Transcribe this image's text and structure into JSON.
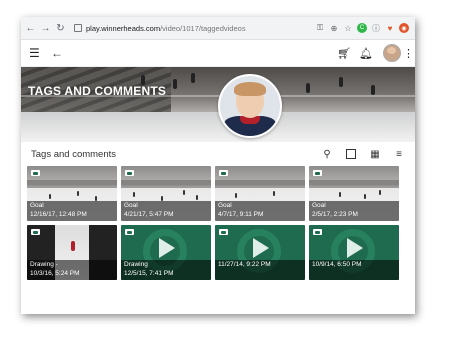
{
  "browser": {
    "url_host": "play.winnerheads.com",
    "url_path": "/video/1017/taggedvideos"
  },
  "hero": {
    "title": "TAGS AND COMMENTS"
  },
  "section": {
    "title": "Tags and comments"
  },
  "tiles": [
    {
      "type": "video",
      "title": "Goal",
      "date": "12/16/17, 12:48 PM"
    },
    {
      "type": "video",
      "title": "Goal",
      "date": "4/21/17, 5:47 PM"
    },
    {
      "type": "video",
      "title": "Goal",
      "date": "4/7/17, 9:11 PM"
    },
    {
      "type": "video",
      "title": "Goal",
      "date": "2/5/17, 2:23 PM"
    },
    {
      "type": "drawing-photo",
      "title": "Drawing -",
      "date": "10/3/16, 5:24 PM"
    },
    {
      "type": "drawing",
      "title": "Drawing",
      "date": "12/5/15, 7:41 PM"
    },
    {
      "type": "drawing",
      "title": "",
      "date": "11/27/14, 9:22 PM"
    },
    {
      "type": "drawing",
      "title": "",
      "date": "10/9/14, 6:50 PM"
    }
  ],
  "icons": {
    "browser": [
      "back-icon",
      "forward-icon",
      "reload-icon",
      "lock-icon",
      "key-icon",
      "add-icon",
      "star-icon",
      "extension-icon",
      "info-icon",
      "extension-icon",
      "extension-icon"
    ],
    "app": [
      "menu-icon",
      "back-arrow-icon",
      "cart-icon",
      "bell-icon",
      "avatar",
      "more-vert-icon"
    ],
    "tools": [
      "search-icon",
      "square-view-icon",
      "grid-view-icon",
      "list-view-icon"
    ]
  },
  "colors": {
    "brand_green": "#1f6b4f",
    "ext_green": "#2fb84a",
    "ext_orange": "#e0552a"
  }
}
